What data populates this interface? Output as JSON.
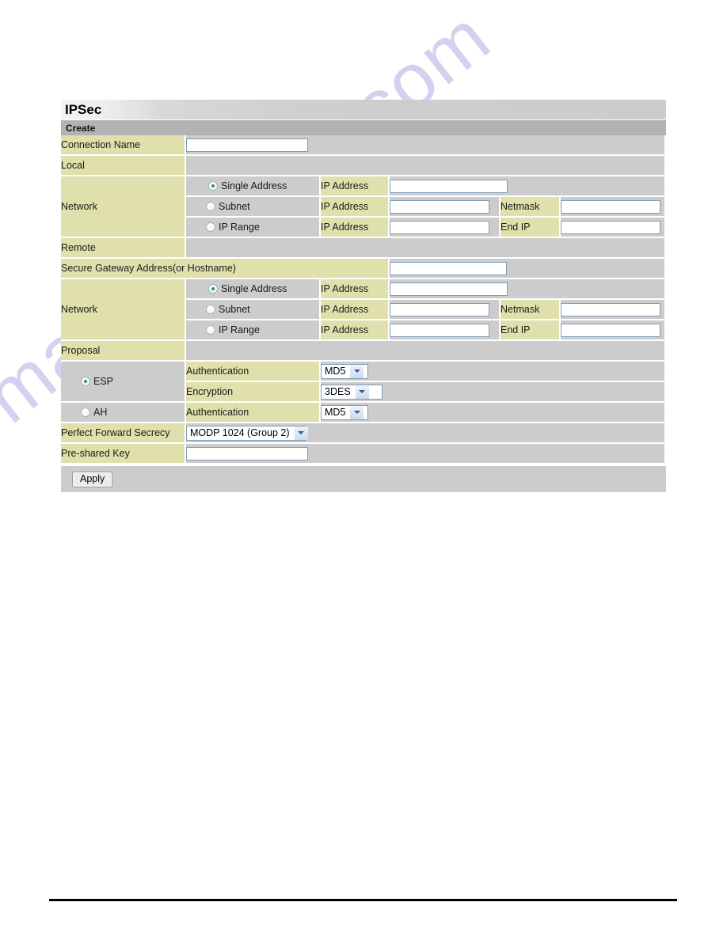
{
  "page": {
    "title": "IPSec",
    "section": "Create",
    "watermark": "manualshive.com"
  },
  "colors": {
    "label_bg": "#e0e0ac",
    "cell_bg": "#cccccc",
    "header_bg": "#b2b2b2",
    "radio_dot": "#2e9b2e",
    "input_border": "#7f9db9"
  },
  "form": {
    "connection_name": {
      "label": "Connection Name",
      "value": "",
      "placeholder": ""
    },
    "local": {
      "label": "Local",
      "network_label": "Network",
      "options": [
        {
          "label": "Single Address",
          "selected": true
        },
        {
          "label": "Subnet",
          "selected": false
        },
        {
          "label": "IP Range",
          "selected": false
        }
      ],
      "rows": [
        {
          "field1_label": "IP Address",
          "field1_value": "",
          "field2_label": "",
          "field2_value": ""
        },
        {
          "field1_label": "IP Address",
          "field1_value": "",
          "field2_label": "Netmask",
          "field2_value": ""
        },
        {
          "field1_label": "IP Address",
          "field1_value": "",
          "field2_label": "End IP",
          "field2_value": ""
        }
      ]
    },
    "remote": {
      "label": "Remote",
      "secure_gateway_label": "Secure Gateway Address(or Hostname)",
      "secure_gateway_value": "",
      "network_label": "Network",
      "options": [
        {
          "label": "Single Address",
          "selected": true
        },
        {
          "label": "Subnet",
          "selected": false
        },
        {
          "label": "IP Range",
          "selected": false
        }
      ],
      "rows": [
        {
          "field1_label": "IP Address",
          "field1_value": "",
          "field2_label": "",
          "field2_value": ""
        },
        {
          "field1_label": "IP Address",
          "field1_value": "",
          "field2_label": "Netmask",
          "field2_value": ""
        },
        {
          "field1_label": "IP Address",
          "field1_value": "",
          "field2_label": "End IP",
          "field2_value": ""
        }
      ]
    },
    "proposal": {
      "label": "Proposal",
      "esp": {
        "label": "ESP",
        "selected": true,
        "authentication_label": "Authentication",
        "authentication_value": "MD5",
        "encryption_label": "Encryption",
        "encryption_value": "3DES"
      },
      "ah": {
        "label": "AH",
        "selected": false,
        "authentication_label": "Authentication",
        "authentication_value": "MD5"
      }
    },
    "pfs": {
      "label": "Perfect Forward Secrecy",
      "value": "MODP 1024 (Group 2)"
    },
    "preshared_key": {
      "label": "Pre-shared Key",
      "value": "",
      "placeholder": ""
    },
    "apply_label": "Apply"
  }
}
